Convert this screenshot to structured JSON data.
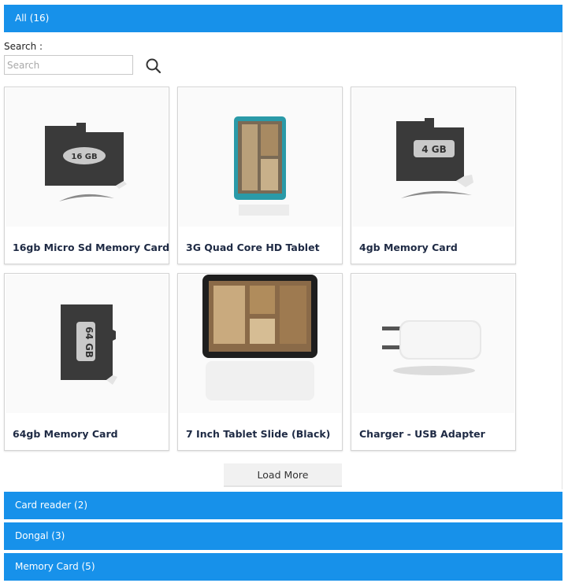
{
  "categories": {
    "all": "All (16)",
    "card_reader": "Card reader (2)",
    "dongal": "Dongal (3)",
    "memory_card": "Memory Card (5)"
  },
  "search": {
    "label": "Search :",
    "placeholder": "Search",
    "value": ""
  },
  "products": [
    {
      "name": "16gb Micro Sd Memory Card",
      "image_text": "16 GB"
    },
    {
      "name": "3G Quad Core HD Tablet"
    },
    {
      "name": "4gb Memory Card",
      "image_text": "4 GB"
    },
    {
      "name": "64gb Memory Card",
      "image_text": "64 GB"
    },
    {
      "name": "7 Inch Tablet Slide (Black)"
    },
    {
      "name": "Charger - USB Adapter"
    }
  ],
  "load_more_label": "Load More",
  "colors": {
    "accent": "#1791ea",
    "title_text": "#1e2a44"
  }
}
